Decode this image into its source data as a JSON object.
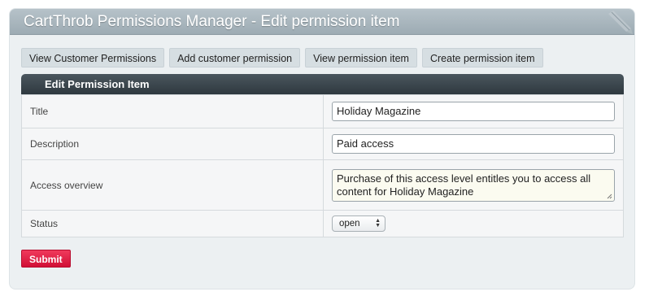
{
  "header": {
    "title": "CartThrob Permissions Manager - Edit permission item"
  },
  "nav": {
    "view_customer_permissions": "View Customer Permissions",
    "add_customer_permission": "Add customer permission",
    "view_permission_item": "View permission item",
    "create_permission_item": "Create permission item"
  },
  "form": {
    "heading": "Edit Permission Item",
    "fields": {
      "title": {
        "label": "Title",
        "value": "Holiday Magazine"
      },
      "description": {
        "label": "Description",
        "value": "Paid access"
      },
      "access_overview": {
        "label": "Access overview",
        "value": "Purchase of this access level entitles you to access all content for Holiday Magazine"
      },
      "status": {
        "label": "Status",
        "value": "open"
      }
    },
    "submit_label": "Submit"
  },
  "colors": {
    "header_bar": "#a7b4bb",
    "form_header": "#36414a",
    "submit": "#e0214a"
  }
}
